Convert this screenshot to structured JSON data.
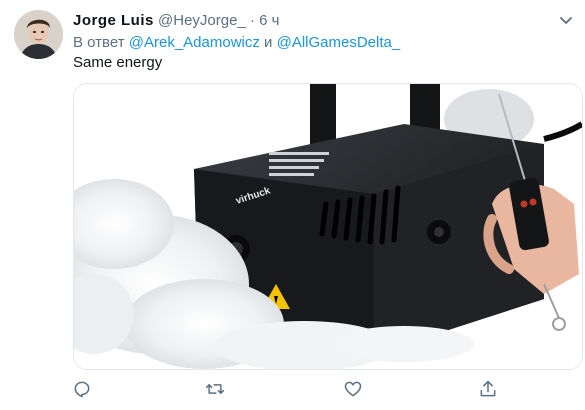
{
  "tweet": {
    "author_name": "Jorge Luis",
    "author_handle": "@HeyJorge_",
    "separator": "·",
    "time": "6 ч",
    "reply_prefix": "В ответ",
    "reply_mention_1": "@Arek_Adamowicz",
    "reply_conjunction": "и",
    "reply_mention_2": "@AllGamesDelta_",
    "text": "Same energy",
    "media": {
      "brand_label": "virhuck",
      "description_icon": "fog-machine-photo"
    },
    "actions": {
      "reply_icon": "reply-icon",
      "retweet_icon": "retweet-icon",
      "like_icon": "like-icon",
      "share_icon": "share-icon"
    }
  },
  "colors": {
    "link": "#1b95e0",
    "secondary_text": "#5b7083",
    "primary_text": "#0f1419",
    "border": "#e1e8ed"
  }
}
